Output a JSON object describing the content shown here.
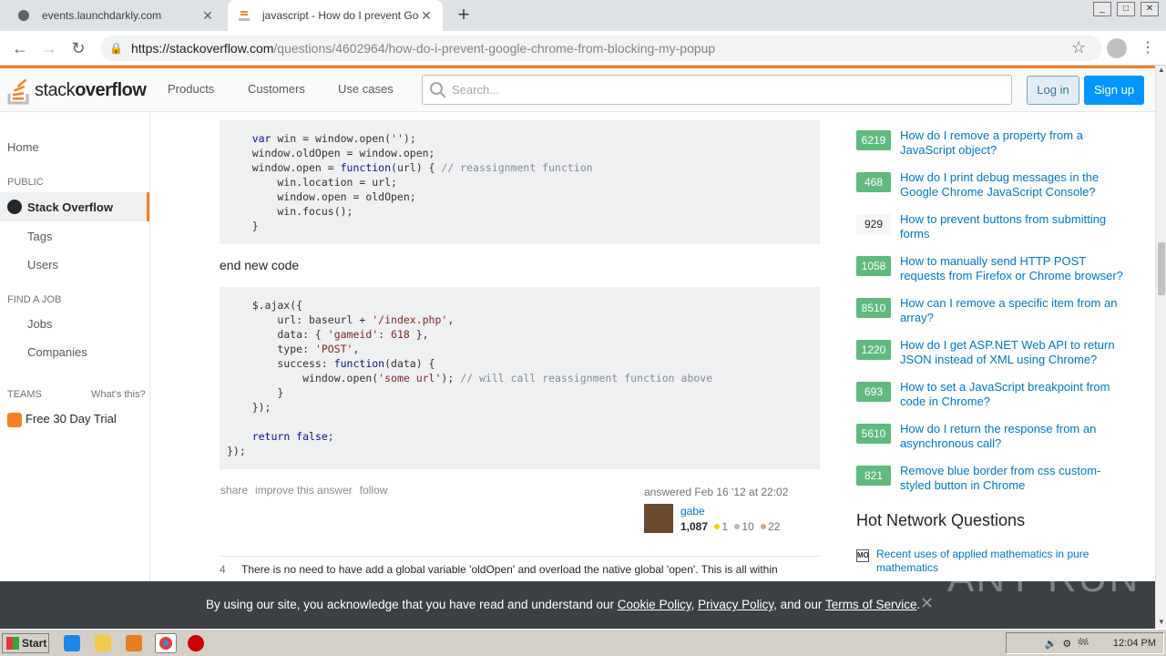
{
  "browser": {
    "tabs": [
      {
        "title": "events.launchdarkly.com"
      },
      {
        "title": "javascript - How do I prevent Google Chrome"
      }
    ],
    "url_host": "https://stackoverflow.com",
    "url_path": "/questions/4602964/how-do-i-prevent-google-chrome-from-blocking-my-popup"
  },
  "header": {
    "logo_light": "stack",
    "logo_bold": "overflow",
    "nav": [
      "Products",
      "Customers",
      "Use cases"
    ],
    "search_placeholder": "Search...",
    "login": "Log in",
    "signup": "Sign up"
  },
  "leftnav": {
    "home": "Home",
    "public": "PUBLIC",
    "stackoverflow": "Stack Overflow",
    "tags": "Tags",
    "users": "Users",
    "find_job": "FIND A JOB",
    "jobs": "Jobs",
    "companies": "Companies",
    "teams": "TEAMS",
    "whats_this": "What's this?",
    "trial": "Free 30 Day Trial"
  },
  "answer": {
    "end_new_code": "end new code",
    "menu": [
      "share",
      "improve this answer",
      "follow"
    ],
    "answered": "answered Feb 16 '12 at 22:02",
    "user": "gabe",
    "rep": "1,087",
    "gold": "1",
    "silver": "10",
    "bronze": "22"
  },
  "next_answer": {
    "score": "4",
    "text": "There is no need to have add a global variable 'oldOpen' and overload the native global 'open'. This is all within"
  },
  "related": [
    {
      "score": "6219",
      "title": "How do I remove a property from a JavaScript object?",
      "accepted": true
    },
    {
      "score": "468",
      "title": "How do I print debug messages in the Google Chrome JavaScript Console?",
      "accepted": true
    },
    {
      "score": "929",
      "title": "How to prevent buttons from submitting forms",
      "accepted": false
    },
    {
      "score": "1058",
      "title": "How to manually send HTTP POST requests from Firefox or Chrome browser?",
      "accepted": true
    },
    {
      "score": "8510",
      "title": "How can I remove a specific item from an array?",
      "accepted": true
    },
    {
      "score": "1220",
      "title": "How do I get ASP.NET Web API to return JSON instead of XML using Chrome?",
      "accepted": true
    },
    {
      "score": "693",
      "title": "How to set a JavaScript breakpoint from code in Chrome?",
      "accepted": true
    },
    {
      "score": "5610",
      "title": "How do I return the response from an asynchronous call?",
      "accepted": true
    },
    {
      "score": "821",
      "title": "Remove blue border from css custom-styled button in Chrome",
      "accepted": true
    }
  ],
  "hot_network": {
    "title": "Hot Network Questions",
    "items": [
      {
        "site": "MO",
        "title": "Recent uses of applied mathematics in pure mathematics"
      }
    ]
  },
  "cookie": {
    "pre": "By using our site, you acknowledge that you have read and understand our ",
    "cookie_policy": "Cookie Policy",
    "comma": ", ",
    "privacy_policy": "Privacy Policy",
    "and": ", and our ",
    "terms": "Terms of Service",
    "end": "."
  },
  "watermark": "ANY RUN",
  "taskbar": {
    "start": "Start",
    "clock": "12:04 PM"
  }
}
